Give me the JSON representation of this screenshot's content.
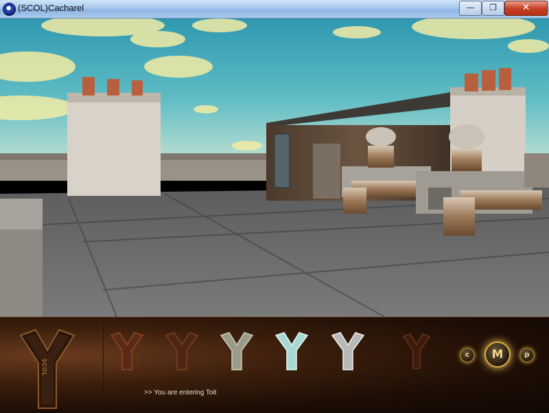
{
  "window": {
    "title": "(SCOL)Cacharel",
    "min_glyph": "—",
    "max_glyph": "❐",
    "close_glyph": "✕"
  },
  "scene": {
    "sky_colors": [
      "#3aa0b6",
      "#6ec3c9",
      "#cfe6d6"
    ],
    "cloud_color": "#f4efa6",
    "floor_color": "#6e6e6e",
    "brick_color": "#b8603e"
  },
  "hud": {
    "logo_label": "SCOL",
    "icons": [
      {
        "name": "y-slot-1-icon",
        "style": "rust"
      },
      {
        "name": "y-slot-2-icon",
        "style": "rust"
      },
      {
        "name": "y-slot-3-icon",
        "style": "stone"
      },
      {
        "name": "y-slot-4-icon",
        "style": "ice"
      },
      {
        "name": "y-slot-5-icon",
        "style": "silver"
      },
      {
        "name": "y-slot-6-icon",
        "style": "dark-rust"
      }
    ],
    "buttons": {
      "c_label": "c",
      "m_label": "M",
      "p_label": "p"
    },
    "status_text": ">> You are entering Toit"
  }
}
